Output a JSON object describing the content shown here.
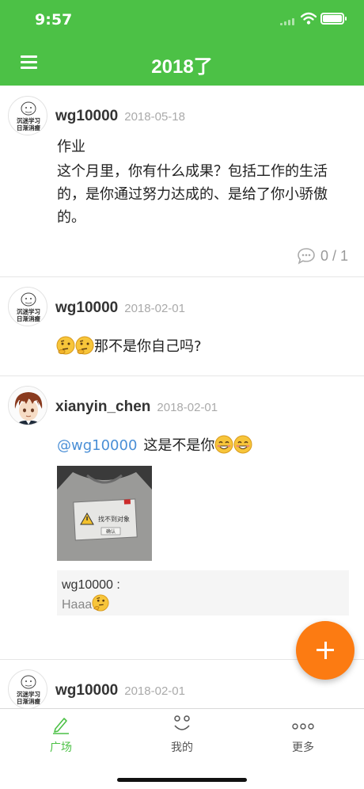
{
  "status_bar": {
    "time": "9:57"
  },
  "header": {
    "title": "2018了",
    "menu_icon": "menu-icon",
    "background": "#4cc146"
  },
  "posts": [
    {
      "username": "wg10000",
      "date": "2018-05-18",
      "avatar_text": [
        "沉迷学习",
        "日渐消瘦"
      ],
      "title": "作业",
      "text": "这个月里，你有什么成果？包括工作的生活的，是你通过努力达成的、是给了你小骄傲的。",
      "comments": "0 / 1"
    },
    {
      "username": "wg10000",
      "date": "2018-02-01",
      "avatar_text": [
        "沉迷学习",
        "日渐消瘦"
      ],
      "text": "那不是你自己吗?"
    },
    {
      "username": "xianyin_chen",
      "date": "2018-02-01",
      "mention": "@wg10000",
      "text": "这是不是你",
      "photo_text": [
        "找不到对象",
        "确认"
      ],
      "quote_user": "wg10000 :",
      "quote_text": "Haaa"
    },
    {
      "username": "wg10000",
      "date": "2018-02-01",
      "avatar_text": [
        "沉迷学习",
        "日渐消瘦"
      ]
    }
  ],
  "fab": {
    "icon": "plus-icon",
    "color": "#fc7b12"
  },
  "tabs": [
    {
      "label": "广场",
      "icon": "pen-icon",
      "active": true
    },
    {
      "label": "我的",
      "icon": "smile-icon",
      "active": false
    },
    {
      "label": "更多",
      "icon": "more-icon",
      "active": false
    }
  ]
}
